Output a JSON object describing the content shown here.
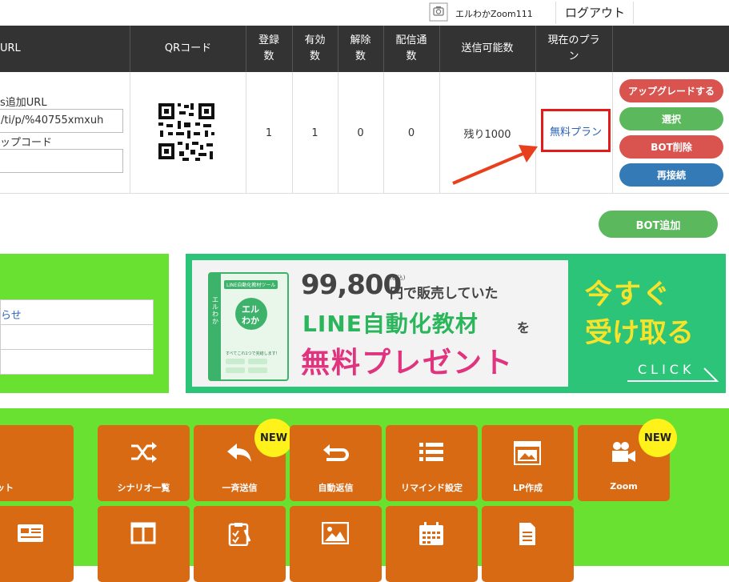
{
  "header": {
    "account_name": "エルわかZoom111",
    "logout_label": "ログアウト"
  },
  "table": {
    "columns": [
      "URL",
      "QRコード",
      "登録\n数",
      "有効\n数",
      "解除\n数",
      "配信通\n数",
      "送信可能数",
      "現在のプラ\nン"
    ],
    "row": {
      "url_label_1": "s追加URL",
      "url_value": "/ti/p/%40755xmxuh",
      "url_label_2": "ップコード",
      "url_value_2": "",
      "registered": "1",
      "active": "1",
      "cancelled": "0",
      "delivered": "0",
      "sendable": "残り1000",
      "plan": "無料プラン"
    },
    "actions": {
      "upgrade": "アップグレードする",
      "select": "選択",
      "delete_bot": "BOT削除",
      "reconnect": "再接続"
    }
  },
  "bot_add_label": "BOT追加",
  "notice": {
    "items": [
      "らせ",
      "",
      ""
    ]
  },
  "banner": {
    "price": "99,800",
    "price_tax": "(税込)",
    "price_suffix": "円で販売していた",
    "line2_main": "LINE自動化教材",
    "line2_suffix": "を",
    "line3": "無料プレゼント",
    "cta_1": "今すぐ",
    "cta_2": "受け取る",
    "click": "CLICK",
    "book_title": "LINE自動化教材ツール",
    "book_name_1": "エル",
    "book_name_2": "わか",
    "book_side": "エルわか",
    "book_tagline": "すべてこれ1つで完結します!"
  },
  "menu": {
    "row1": [
      {
        "label": "ット",
        "icon": "list-icon",
        "new": false
      },
      {
        "label": "シナリオ一覧",
        "icon": "shuffle-icon",
        "new": false
      },
      {
        "label": "一斉送信",
        "icon": "reply-icon",
        "new": true
      },
      {
        "label": "自動返信",
        "icon": "return-icon",
        "new": false
      },
      {
        "label": "リマインド設定",
        "icon": "list-bullets-icon",
        "new": false
      },
      {
        "label": "LP作成",
        "icon": "webpage-icon",
        "new": false
      },
      {
        "label": "Zoom",
        "icon": "video-camera-icon",
        "new": true
      }
    ],
    "row2": [
      {
        "label": "",
        "icon": "card-icon"
      },
      {
        "label": "",
        "icon": "columns-icon"
      },
      {
        "label": "",
        "icon": "clipboard-icon"
      },
      {
        "label": "",
        "icon": "image-icon"
      },
      {
        "label": "",
        "icon": "calendar-icon"
      },
      {
        "label": "",
        "icon": "document-icon"
      }
    ],
    "new_badge": "NEW"
  },
  "colors": {
    "header_bg": "#333333",
    "green_btn": "#5cb85c",
    "red_btn": "#d9534f",
    "blue_btn": "#337ab7",
    "tile_orange": "#d86a14",
    "lime": "#69e131",
    "highlight_red": "#e21b1b"
  }
}
